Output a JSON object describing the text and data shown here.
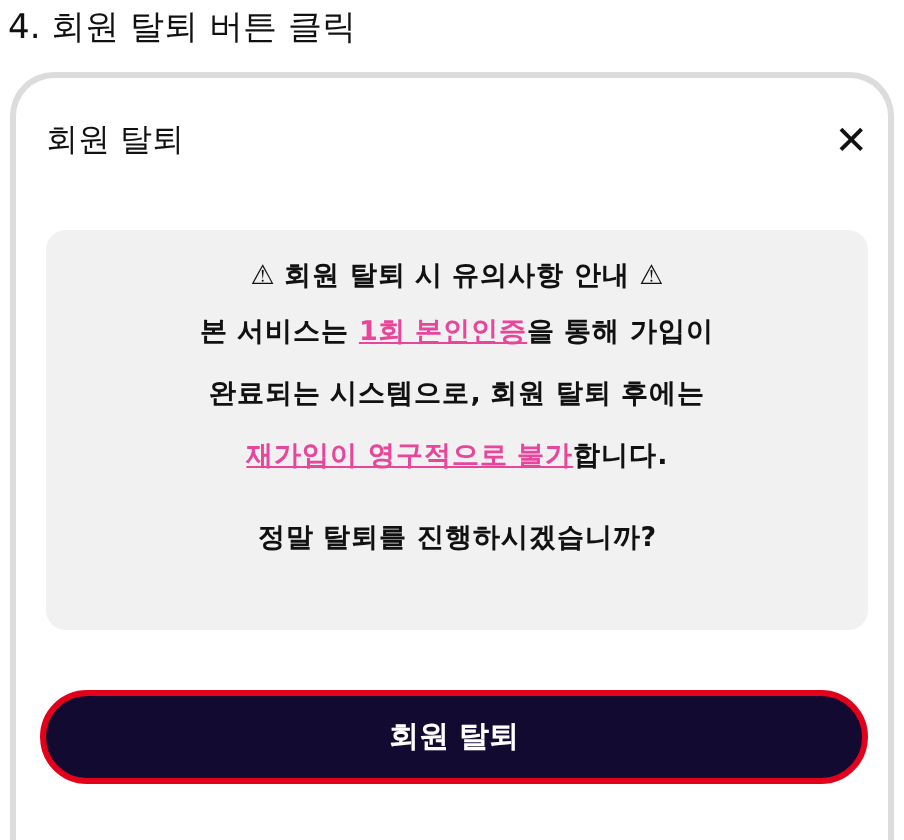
{
  "heading": "4. 회원 탈퇴 버튼 클릭",
  "dialog": {
    "title": "회원 탈퇴",
    "close": "✕",
    "notice": {
      "title": "⚠ 회원 탈퇴 시 유의사항 안내 ⚠",
      "body": "본 서비스는 **1회 본인인증**을 통해 가입이 완료되는 시스템으로, 회원 탈퇴 후에는 **재가입이 영구적으로 불가**합니다.",
      "question": "정말 탈퇴를 진행하시겠습니까?"
    },
    "button": {
      "label": "회원 탈퇴",
      "highlighted": true
    }
  }
}
